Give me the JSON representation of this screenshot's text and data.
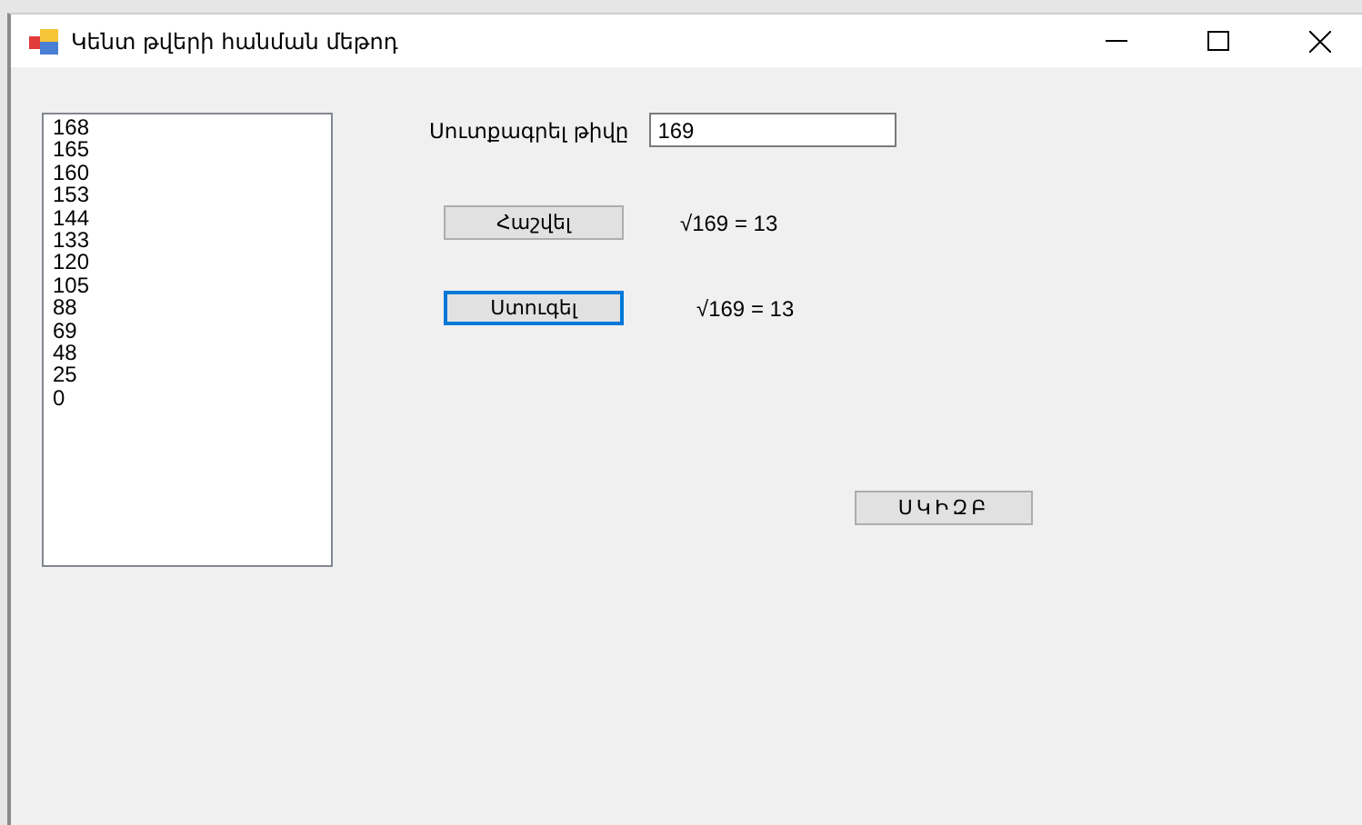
{
  "window": {
    "title": "Կենտ թվերի հանման մեթոդ"
  },
  "list": {
    "items": [
      "168",
      "165",
      "160",
      "153",
      "144",
      "133",
      "120",
      "105",
      "88",
      "69",
      "48",
      "25",
      "0"
    ]
  },
  "input": {
    "label": "Սուտքագրել թիվը",
    "value": "169"
  },
  "actions": [
    {
      "label": "Հաշվել",
      "focused": false,
      "result": "√169 = 13"
    },
    {
      "label": "Ստուգել",
      "focused": true,
      "result": "√169 = 13"
    }
  ],
  "start_button": {
    "label": "ՍԿԻԶԲ",
    "focused": false
  }
}
